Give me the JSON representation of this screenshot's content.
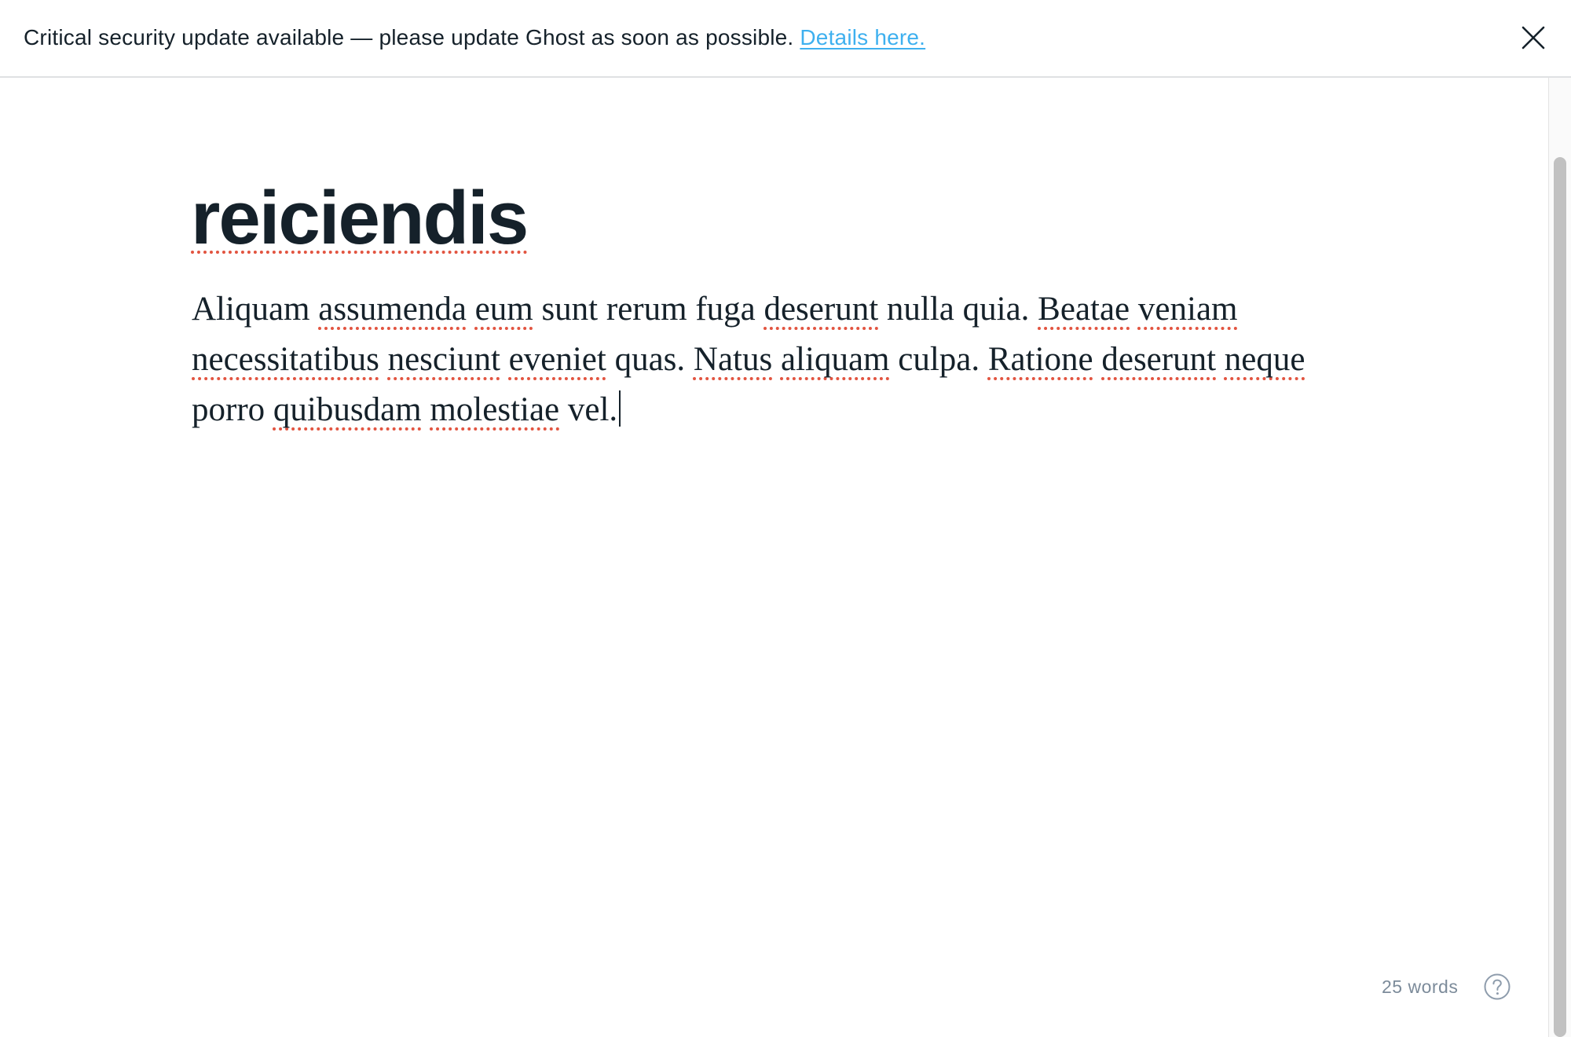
{
  "banner": {
    "message": "Critical security update available — please update Ghost as soon as possible.",
    "link_text": "Details here.",
    "link_color": "#3eb0ef",
    "close_icon": "close-icon"
  },
  "editor": {
    "title": "reiciendis",
    "body_words": [
      {
        "t": "Aliquam",
        "s": false
      },
      {
        "t": "assumenda",
        "s": true
      },
      {
        "t": "eum",
        "s": true
      },
      {
        "t": "sunt",
        "s": false
      },
      {
        "t": "rerum",
        "s": false
      },
      {
        "t": "fuga",
        "s": false
      },
      {
        "t": "deserunt",
        "s": true
      },
      {
        "t": "nulla",
        "s": false
      },
      {
        "t": "quia.",
        "s": false
      },
      {
        "t": "Beatae",
        "s": true
      },
      {
        "t": "veniam",
        "s": true
      },
      {
        "t": "necessitatibus",
        "s": true
      },
      {
        "t": "nesciunt",
        "s": true
      },
      {
        "t": "eveniet",
        "s": true
      },
      {
        "t": "quas.",
        "s": false
      },
      {
        "t": "Natus",
        "s": true
      },
      {
        "t": "aliquam",
        "s": true
      },
      {
        "t": "culpa.",
        "s": false
      },
      {
        "t": "Ratione",
        "s": true
      },
      {
        "t": "deserunt",
        "s": true
      },
      {
        "t": "neque",
        "s": true
      },
      {
        "t": "porro",
        "s": false
      },
      {
        "t": "quibusdam",
        "s": true
      },
      {
        "t": "molestiae",
        "s": true
      },
      {
        "t": "vel.",
        "s": false
      }
    ],
    "spellcheck_color": "#e25440"
  },
  "status": {
    "word_count": "25 words",
    "help_icon": "help-circle-icon"
  }
}
